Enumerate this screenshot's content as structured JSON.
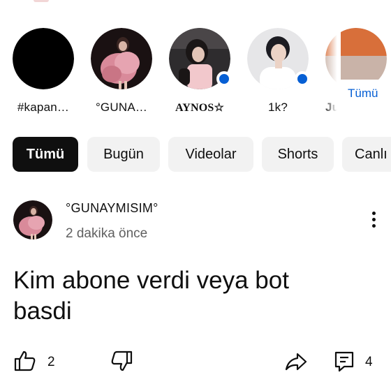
{
  "channels": {
    "items": [
      {
        "name": "#kapan…",
        "avatar": "channel-avatar-black",
        "new_content": false
      },
      {
        "name": "°GUNA…",
        "avatar": "channel-avatar-pink-fur",
        "new_content": false
      },
      {
        "name": "AYNOS☆",
        "avatar": "channel-avatar-girl-dark",
        "new_content": true
      },
      {
        "name": "1k?",
        "avatar": "channel-avatar-boy-white-shirt",
        "new_content": true
      },
      {
        "name": "Ju",
        "avatar": "channel-avatar-partial",
        "new_content": false
      }
    ],
    "all_link": "Tümü",
    "new_dot_color": "#065fd4"
  },
  "chips": {
    "items": [
      "Tümü",
      "Bugün",
      "Videolar",
      "Shorts",
      "Canlı"
    ],
    "selected": "Tümü"
  },
  "post": {
    "author": "°GUNAYMISIM°",
    "time": "2 dakika önce",
    "text": "Kim abone verdi veya bot basdi",
    "likes": "2",
    "comments": "4"
  },
  "colors": {
    "accent": "#065fd4",
    "chip_active_bg": "#0f0f0f",
    "chip_bg": "#f2f2f2",
    "secondary_text": "#606060"
  }
}
